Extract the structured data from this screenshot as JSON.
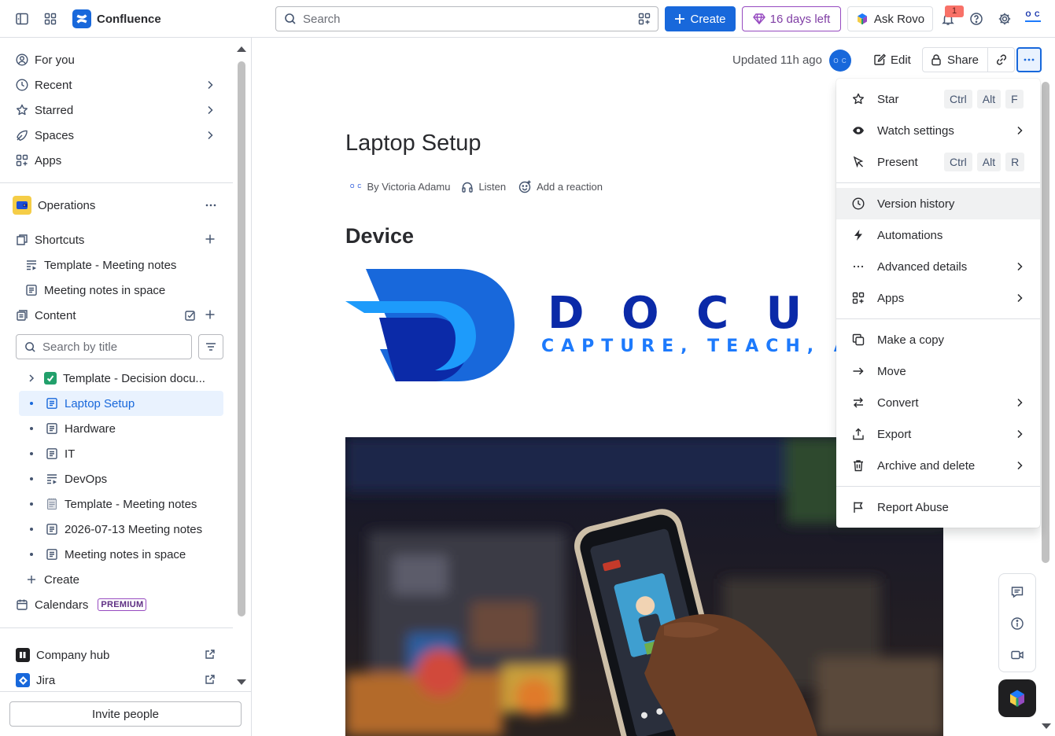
{
  "app": {
    "name": "Confluence"
  },
  "topbar": {
    "search_placeholder": "Search",
    "create_label": "Create",
    "trial_label": "16 days left",
    "rovo_label": "Ask Rovo",
    "notification_count": "1",
    "avatar_initials": "O C"
  },
  "sidebar": {
    "nav": [
      {
        "label": "For you",
        "icon": "user-circle-icon"
      },
      {
        "label": "Recent",
        "icon": "clock-icon"
      },
      {
        "label": "Starred",
        "icon": "star-icon"
      },
      {
        "label": "Spaces",
        "icon": "spaces-icon"
      },
      {
        "label": "Apps",
        "icon": "apps-grid-icon"
      }
    ],
    "space_name": "Operations",
    "shortcuts_label": "Shortcuts",
    "shortcuts": [
      {
        "label": "Template - Meeting notes",
        "icon": "template-icon"
      },
      {
        "label": "Meeting notes in space",
        "icon": "page-icon"
      }
    ],
    "content_label": "Content",
    "search_placeholder": "Search by title",
    "tree": [
      {
        "label": "Template - Decision docu...",
        "icon": "checkbox-emoji-icon",
        "selected": false
      },
      {
        "label": "Laptop Setup",
        "icon": "page-icon",
        "selected": true
      },
      {
        "label": "Hardware",
        "icon": "page-icon",
        "selected": false
      },
      {
        "label": "IT",
        "icon": "page-icon",
        "selected": false
      },
      {
        "label": "DevOps",
        "icon": "template-icon",
        "selected": false
      },
      {
        "label": "Template - Meeting notes",
        "icon": "notepad-emoji-icon",
        "selected": false
      },
      {
        "label": "2026-07-13 Meeting notes",
        "icon": "page-icon",
        "selected": false
      },
      {
        "label": "Meeting notes in space",
        "icon": "page-icon",
        "selected": false
      }
    ],
    "create_label": "Create",
    "calendars_label": "Calendars",
    "premium_badge": "PREMIUM",
    "company_hub_label": "Company hub",
    "jira_label": "Jira",
    "invite_label": "Invite people"
  },
  "page": {
    "updated_text": "Updated 11h ago",
    "owner_initials": "O C",
    "edit_label": "Edit",
    "share_label": "Share",
    "title": "Laptop Setup",
    "byline": "By Victoria Adamu",
    "listen_label": "Listen",
    "reaction_label": "Add a reaction",
    "heading": "Device",
    "logo_text": "D O C U F A",
    "logo_tagline": "CAPTURE, TEACH, AU"
  },
  "menu": {
    "items": [
      {
        "label": "Star",
        "icon": "star-icon",
        "keys": [
          "Ctrl",
          "Alt",
          "F"
        ]
      },
      {
        "label": "Watch settings",
        "icon": "eye-icon",
        "submenu": true
      },
      {
        "label": "Present",
        "icon": "present-icon",
        "keys": [
          "Ctrl",
          "Alt",
          "R"
        ]
      },
      {
        "label": "Version history",
        "icon": "clock-icon",
        "hover": true
      },
      {
        "label": "Automations",
        "icon": "lightning-icon"
      },
      {
        "label": "Advanced details",
        "icon": "more-icon",
        "submenu": true
      },
      {
        "label": "Apps",
        "icon": "apps-grid-icon",
        "submenu": true
      },
      {
        "label": "Make a copy",
        "icon": "copy-icon"
      },
      {
        "label": "Move",
        "icon": "arrow-right-icon"
      },
      {
        "label": "Convert",
        "icon": "swap-icon",
        "submenu": true
      },
      {
        "label": "Export",
        "icon": "export-icon",
        "submenu": true
      },
      {
        "label": "Archive and delete",
        "icon": "trash-icon",
        "submenu": true
      },
      {
        "label": "Report Abuse",
        "icon": "flag-icon"
      }
    ]
  },
  "colors": {
    "brand_blue": "#1868db",
    "trial_purple": "#803fa5",
    "selected_bg": "#e9f2fe",
    "menu_hover_bg": "#f0f1f2",
    "logo_dark_blue": "#0b2aa8"
  }
}
